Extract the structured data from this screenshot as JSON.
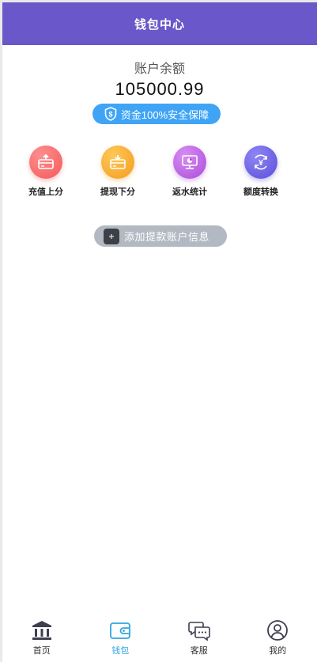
{
  "header": {
    "title": "钱包中心"
  },
  "balance": {
    "label": "账户余额",
    "value": "105000.99",
    "safety_badge": "资金100%安全保障"
  },
  "actions": [
    {
      "label": "充值上分",
      "icon": "upload-card-icon",
      "color": "#f36b6b"
    },
    {
      "label": "提现下分",
      "icon": "download-card-icon",
      "color": "#f7a42a"
    },
    {
      "label": "返水统计",
      "icon": "monitor-chart-icon",
      "color": "#b45be0"
    },
    {
      "label": "额度转换",
      "icon": "yen-exchange-icon",
      "color": "#6c5ce7"
    }
  ],
  "add_account": {
    "label": "添加提款账户信息",
    "icon": "plus-icon"
  },
  "tabbar": {
    "items": [
      {
        "label": "首页",
        "icon": "bank-icon",
        "active": false
      },
      {
        "label": "钱包",
        "icon": "wallet-icon",
        "active": true
      },
      {
        "label": "客服",
        "icon": "chat-icon",
        "active": false
      },
      {
        "label": "我的",
        "icon": "user-icon",
        "active": false
      }
    ],
    "active_color": "#2fa6e0"
  },
  "colors": {
    "header": "#6a57c9",
    "badge": "#3fa4f6",
    "add_button": "#b3b9c3"
  }
}
